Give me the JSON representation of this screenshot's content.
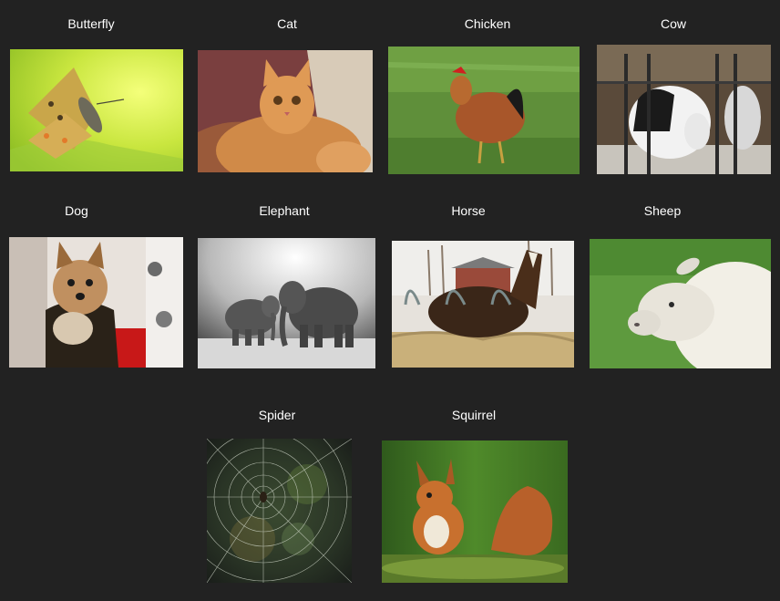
{
  "animals": [
    {
      "label": "Butterfly"
    },
    {
      "label": "Cat"
    },
    {
      "label": "Chicken"
    },
    {
      "label": "Cow"
    },
    {
      "label": "Dog"
    },
    {
      "label": "Elephant"
    },
    {
      "label": "Horse"
    },
    {
      "label": "Sheep"
    },
    {
      "label": "Spider"
    },
    {
      "label": "Squirrel"
    }
  ]
}
